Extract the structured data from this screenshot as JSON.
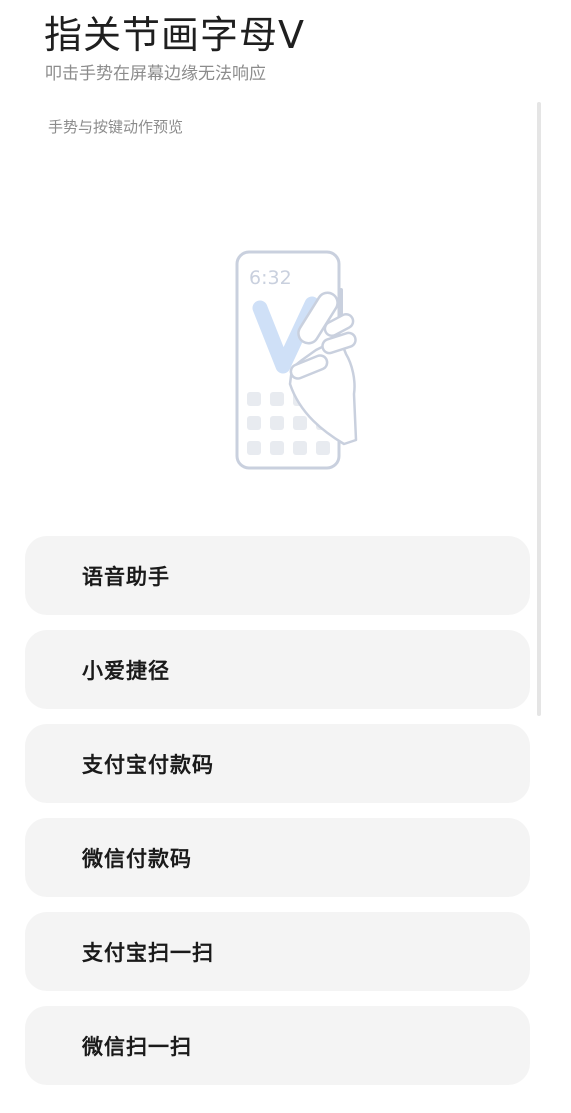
{
  "header": {
    "title": "指关节画字母V",
    "subtitle": "叩击手势在屏幕边缘无法响应"
  },
  "preview": {
    "section_label": "手势与按键动作预览",
    "phone_time": "6:32",
    "gesture_letter": "V",
    "accent_color": "#cfe0f7",
    "outline_color": "#c9d0de"
  },
  "options": [
    {
      "label": "语音助手"
    },
    {
      "label": "小爱捷径"
    },
    {
      "label": "支付宝付款码"
    },
    {
      "label": "微信付款码"
    },
    {
      "label": "支付宝扫一扫"
    },
    {
      "label": "微信扫一扫"
    }
  ]
}
